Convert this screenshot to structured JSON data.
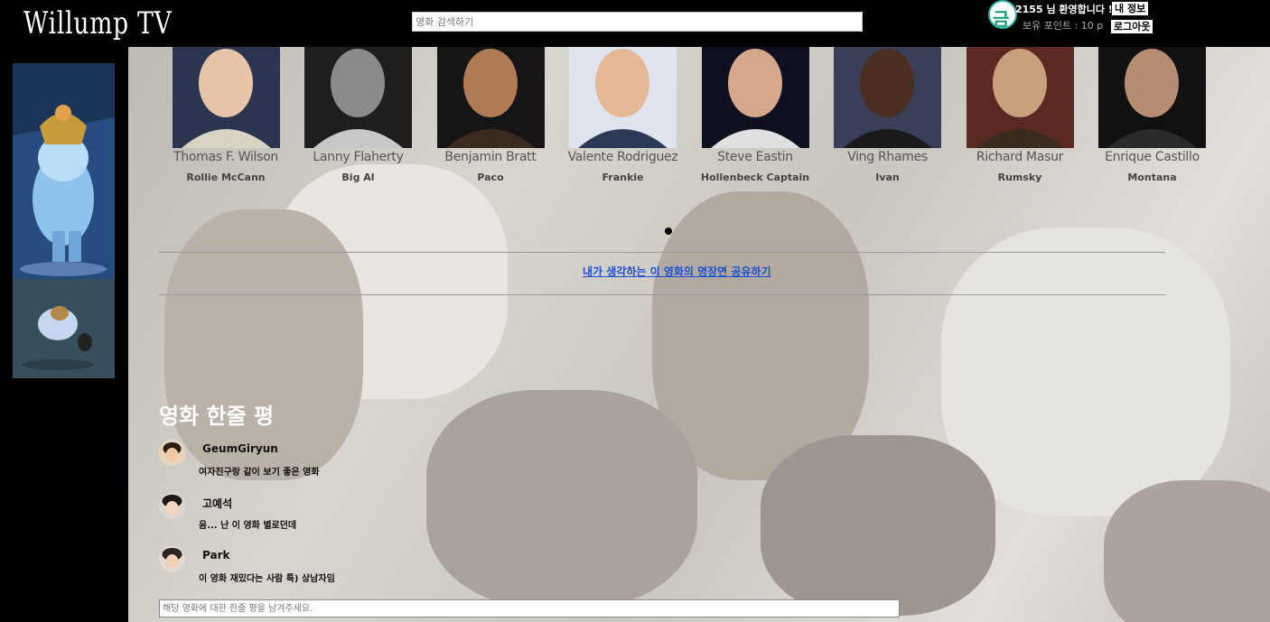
{
  "header": {
    "logo": "Willump TV",
    "search_placeholder": "영화 검색하기",
    "user_avatar_text": "금도",
    "welcome": "2155 님 환영합니다 !",
    "points": "보유 포인트 : 10 p",
    "my_info_label": "내 정보",
    "logout_label": "로그아웃"
  },
  "cast": [
    {
      "actor": "Thomas F. Wilson",
      "role": "Rollie McCann"
    },
    {
      "actor": "Lanny Flaherty",
      "role": "Big Al"
    },
    {
      "actor": "Benjamin Bratt",
      "role": "Paco"
    },
    {
      "actor": "Valente Rodriguez",
      "role": "Frankie"
    },
    {
      "actor": "Steve Eastin",
      "role": "Hollenbeck Captain"
    },
    {
      "actor": "Ving Rhames",
      "role": "Ivan"
    },
    {
      "actor": "Richard Masur",
      "role": "Rumsky"
    },
    {
      "actor": "Enrique Castillo",
      "role": "Montana"
    }
  ],
  "share_link": "내가 생각하는 이 영화의 명장면 공유하기",
  "reviews": {
    "title": "영화 한줄 평",
    "items": [
      {
        "name": "GeumGiryun",
        "text": "여자친구랑 같이 보기 좋은 영화"
      },
      {
        "name": "고예석",
        "text": "음... 난 이 영화 별로던데"
      },
      {
        "name": "Park",
        "text": "이 영화 재밌다는 사람 특) 상남자임"
      }
    ],
    "input_placeholder": "해당 영화에 대한 한줄 평을 남겨주세요."
  },
  "colors": {
    "accent_link": "#1a4fd6",
    "header_bg": "#000000",
    "avatar_ring": "#2bb3a1"
  }
}
